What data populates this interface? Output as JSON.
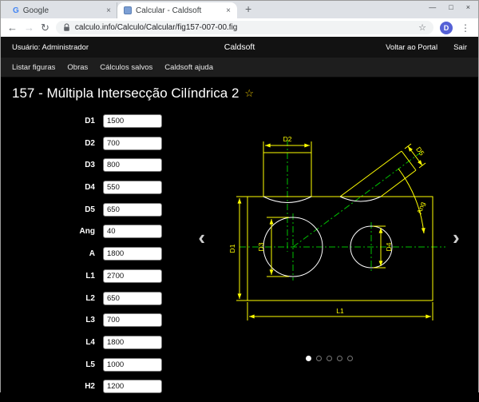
{
  "colors": {
    "dimension_yellow": "#ffff00",
    "centerline_green": "#00c000",
    "drawing_white": "#ffffff",
    "favorite_star_yellow": "#e7c300",
    "avatar_blue": "#5561d6"
  },
  "browser": {
    "tabs": [
      {
        "title": "Google",
        "favicon_letter": "G"
      },
      {
        "title": "Calcular - Caldsoft"
      }
    ],
    "tab_close_icon": "×",
    "new_tab_icon": "+",
    "window_controls": {
      "minimize": "—",
      "maximize": "□",
      "close": "×"
    },
    "nav_icons": {
      "back": "←",
      "forward": "→",
      "reload": "↻",
      "star": "☆",
      "menu": "⋮"
    },
    "url": "calculo.info/Calculo/Calcular/fig157-007-00.fig",
    "avatar_letter": "D"
  },
  "site_header": {
    "user": "Usuário: Administrador",
    "brand": "Caldsoft",
    "links": [
      {
        "label": "Voltar ao Portal"
      },
      {
        "label": "Sair"
      }
    ]
  },
  "site_nav": {
    "items": [
      {
        "label": "Listar figuras"
      },
      {
        "label": "Obras"
      },
      {
        "label": "Cálculos salvos"
      },
      {
        "label": "Caldsoft ajuda"
      }
    ]
  },
  "page": {
    "title": "157 - Múltipla Intersecção Cilíndrica 2",
    "favorite_icon": "☆"
  },
  "form": {
    "fields": [
      {
        "label": "D1",
        "value": "1500"
      },
      {
        "label": "D2",
        "value": "700"
      },
      {
        "label": "D3",
        "value": "800"
      },
      {
        "label": "D4",
        "value": "550"
      },
      {
        "label": "D5",
        "value": "650"
      },
      {
        "label": "Ang",
        "value": "40"
      },
      {
        "label": "A",
        "value": "1800"
      },
      {
        "label": "L1",
        "value": "2700"
      },
      {
        "label": "L2",
        "value": "650"
      },
      {
        "label": "L3",
        "value": "700"
      },
      {
        "label": "L4",
        "value": "1800"
      },
      {
        "label": "L5",
        "value": "1000"
      },
      {
        "label": "H2",
        "value": "1200"
      }
    ]
  },
  "drawing": {
    "labels": {
      "d1": "D1",
      "d2": "D2",
      "d3": "D3",
      "d4": "D4",
      "d5": "D5",
      "ang": "Ang",
      "l1": "L1"
    }
  },
  "carousel": {
    "prev": "‹",
    "next": "›",
    "dot_count": 5,
    "active_dot": 1
  }
}
